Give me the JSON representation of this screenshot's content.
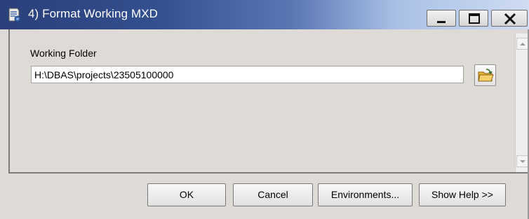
{
  "window": {
    "title": "4) Format Working MXD",
    "icon": "python-script-tool-icon",
    "controls": {
      "minimize": "minimize-icon",
      "maximize": "maximize-icon",
      "close": "close-icon"
    }
  },
  "form": {
    "working_folder_label": "Working Folder",
    "working_folder_value": "H:\\DBAS\\projects\\23505100000",
    "browse_icon": "open-folder-icon"
  },
  "buttons": {
    "ok": "OK",
    "cancel": "Cancel",
    "environments": "Environments...",
    "show_help": "Show Help >>"
  },
  "colors": {
    "title_bar_start": "#2a3f7a",
    "title_bar_end": "#cfdcf2",
    "dialog_background": "#dedbd6"
  }
}
